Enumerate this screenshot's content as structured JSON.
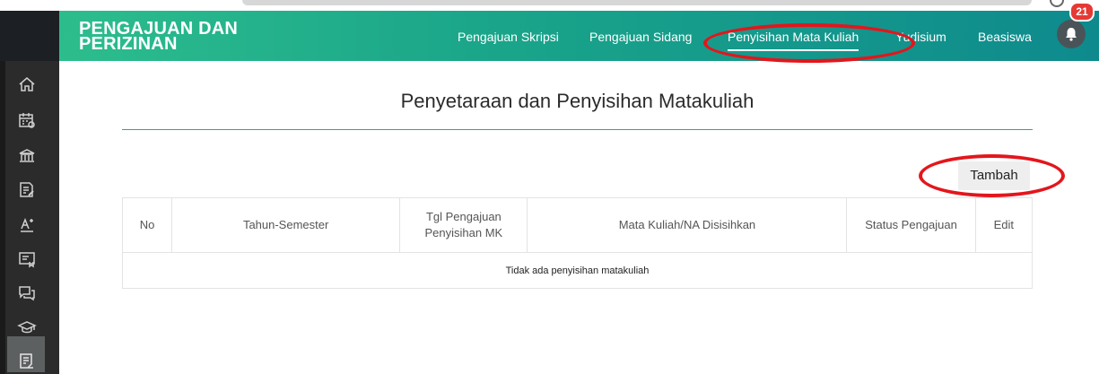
{
  "header": {
    "brand_line1": "PENGAJUAN DAN",
    "brand_line2": "PERIZINAN",
    "nav": [
      {
        "label": "Pengajuan Skripsi"
      },
      {
        "label": "Pengajuan Sidang"
      },
      {
        "label": "Penyisihan Mata Kuliah"
      },
      {
        "label": "Yudisium"
      },
      {
        "label": "Beasiswa"
      }
    ],
    "notification_count": "21"
  },
  "sidebar": {
    "items": [
      {
        "icon": "home-icon"
      },
      {
        "icon": "calendar-icon"
      },
      {
        "icon": "building-icon"
      },
      {
        "icon": "document-edit-icon"
      },
      {
        "icon": "grade-icon"
      },
      {
        "icon": "certificate-icon"
      },
      {
        "icon": "chat-icon"
      },
      {
        "icon": "graduation-cap-icon"
      },
      {
        "icon": "list-document-icon"
      }
    ]
  },
  "main": {
    "page_title": "Penyetaraan dan Penyisihan Matakuliah",
    "add_button": "Tambah",
    "table": {
      "headers": [
        "No",
        "Tahun-Semester",
        "Tgl Pengajuan Penyisihan MK",
        "Mata Kuliah/NA Disisihkan",
        "Status Pengajuan",
        "Edit"
      ],
      "empty_message": "Tidak ada penyisihan matakuliah"
    }
  },
  "colors": {
    "header_gradient_start": "#2fc08d",
    "header_gradient_end": "#0e8a8d",
    "sidebar": "#2b2b2b",
    "annotation": "#e3161c",
    "badge": "#e53935"
  }
}
